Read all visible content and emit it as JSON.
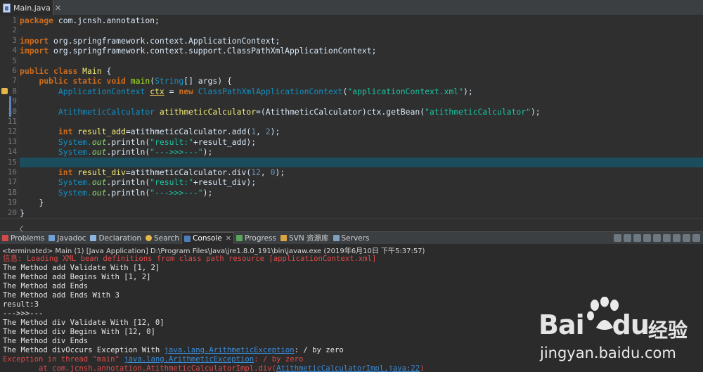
{
  "editor": {
    "tab_label": "Main.java",
    "tab_close": "✕",
    "line_numbers": [
      "1",
      "2",
      "3",
      "4",
      "5",
      "6",
      "7",
      "8",
      "9",
      "10",
      "11",
      "12",
      "13",
      "14",
      "15",
      "16",
      "17",
      "18",
      "19",
      "20"
    ],
    "code": {
      "l1_kw": "package",
      "l1_rest": " com.jcnsh.annotation;",
      "l3_kw": "import",
      "l3_rest": " org.springframework.context.ApplicationContext;",
      "l4_kw": "import",
      "l4_rest": " org.springframework.context.support.ClassPathXmlApplicationContext;",
      "l6_kw1": "public",
      "l6_kw2": "class",
      "l6_name": "Main",
      "l6_rest": " {",
      "l7_kw1": "public",
      "l7_kw2": "static",
      "l7_kw3": "void",
      "l7_name": "main",
      "l7_p1": "(",
      "l7_type": "String",
      "l7_rest": "[] args) {",
      "l8_type": "ApplicationContext",
      "l8_var": "ctx",
      "l8_eq": " = ",
      "l8_kw": "new",
      "l8_cls": "ClassPathXmlApplicationContext",
      "l8_p1": "(",
      "l8_str": "\"applicationContext.xml\"",
      "l8_rest": ");",
      "l10_type": "AtithmeticCalculator",
      "l10_var": "atithmeticCalculator",
      "l10_mid": "=(AtithmeticCalculator)ctx.getBean(",
      "l10_str": "\"atithmeticCalculator\"",
      "l10_rest": ");",
      "l12_kw": "int",
      "l12_var": "result_add",
      "l12_mid": "=atithmeticCalculator.add(",
      "l12_n1": "1",
      "l12_sep": ", ",
      "l12_n2": "2",
      "l12_rest": ");",
      "l13_sys": "System.",
      "l13_out": "out",
      "l13_m": ".println(",
      "l13_str": "\"result:\"",
      "l13_rest": "+result_add);",
      "l14_sys": "System.",
      "l14_out": "out",
      "l14_m": ".println(",
      "l14_str": "\"--->>>---\"",
      "l14_rest": ");",
      "l16_kw": "int",
      "l16_var": "result_div",
      "l16_mid": "=atithmeticCalculator.div(",
      "l16_n1": "12",
      "l16_sep": ", ",
      "l16_n2": "0",
      "l16_rest": ");",
      "l17_sys": "System.",
      "l17_out": "out",
      "l17_m": ".println(",
      "l17_str": "\"result:\"",
      "l17_rest": "+result_div);",
      "l18_sys": "System.",
      "l18_out": "out",
      "l18_m": ".println(",
      "l18_str": "\"--->>>---\"",
      "l18_rest": ");",
      "l19": "}",
      "l20": "}"
    }
  },
  "views": {
    "tabs": [
      {
        "label": "Problems"
      },
      {
        "label": "Javadoc"
      },
      {
        "label": "Declaration"
      },
      {
        "label": "Search"
      },
      {
        "label": "Console"
      },
      {
        "label": "Progress"
      },
      {
        "label": "SVN 资源库"
      },
      {
        "label": "Servers"
      }
    ],
    "console_close": "✕"
  },
  "console": {
    "status": "<terminated> Main (1) [Java Application] D:\\Program Files\\Java\\jre1.8.0_191\\bin\\javaw.exe (2019年6月10日 下午5:37:57)",
    "lines": {
      "info": "信息: Loading XML bean definitions from class path resource [applicationContext.xml]",
      "o1": "The Method add Validate With [1, 2]",
      "o2": "The Method add Begins With [1, 2]",
      "o3": "The Method add Ends",
      "o4": "The Method add Ends With 3",
      "o5": "result:3",
      "o6": "--->>>---",
      "o7": "The Method div Validate With [12, 0]",
      "o8": "The Method div Begins With [12, 0]",
      "o9": "The Method div Ends",
      "o10_pre": "The Method divOccurs Exception With ",
      "o10_link": "java.lang.ArithmeticException",
      "o10_post": ": / by zero",
      "e1_pre": "Exception in thread \"main\" ",
      "e1_link": "java.lang.ArithmeticException",
      "e1_post": ": / by zero",
      "e2_pre": "\tat com.jcnsh.annotation.AtithmeticCalculatorImpl.div(",
      "e2_link": "AtithmeticCalculatorImpl.java:22",
      "e2_post": ")"
    }
  },
  "watermark": {
    "brand": "Bai",
    "brand_du": "du",
    "brand_cn": "经验",
    "url": "jingyan.baidu.com"
  },
  "colors": {
    "editor_bg": "#2f2f2f",
    "current_line": "#1b4d5c",
    "keyword": "#cc6c1d",
    "string": "#17c6a3",
    "error": "#e04a4a",
    "link": "#3b8bd8"
  }
}
